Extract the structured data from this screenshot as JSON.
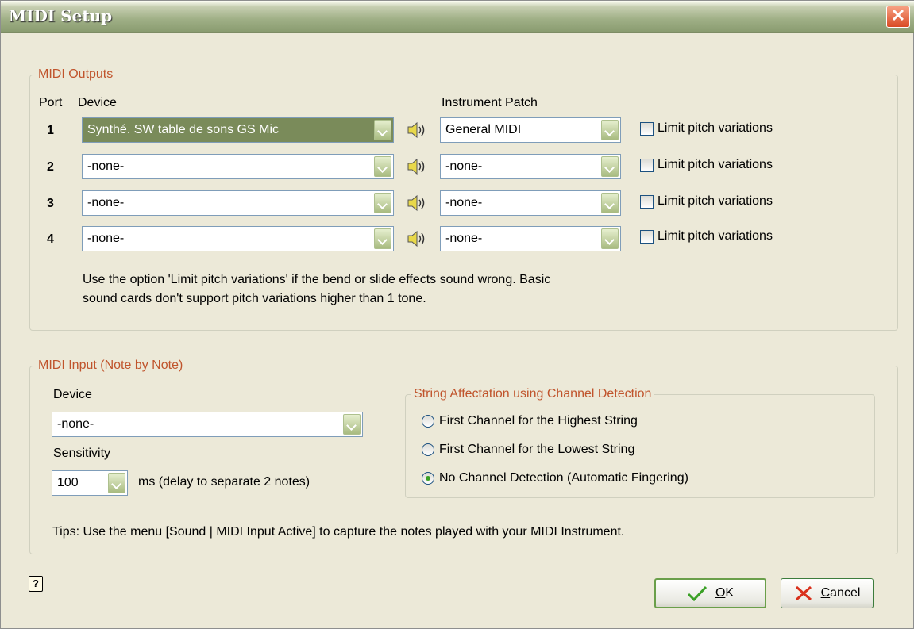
{
  "window": {
    "title": "MIDI Setup",
    "close_glyph": "✕"
  },
  "outputs": {
    "legend": "MIDI Outputs",
    "header_port": "Port",
    "header_device": "Device",
    "header_patch": "Instrument Patch",
    "rows": [
      {
        "port": "1",
        "device": "Synthé. SW table de sons GS Mic",
        "patch": "General MIDI",
        "limit_label": "Limit pitch variations",
        "limit_checked": false
      },
      {
        "port": "2",
        "device": "-none-",
        "patch": "-none-",
        "limit_label": "Limit pitch variations",
        "limit_checked": false
      },
      {
        "port": "3",
        "device": "-none-",
        "patch": "-none-",
        "limit_label": "Limit pitch variations",
        "limit_checked": false
      },
      {
        "port": "4",
        "device": "-none-",
        "patch": "-none-",
        "limit_label": "Limit pitch variations",
        "limit_checked": false
      }
    ],
    "note_line1": "Use the option 'Limit pitch variations' if the bend or slide effects sound wrong. Basic",
    "note_line2": "sound cards don't support pitch variations higher than 1 tone."
  },
  "input": {
    "legend": "MIDI Input (Note by Note)",
    "device_label": "Device",
    "device_value": "-none-",
    "sensitivity_label": "Sensitivity",
    "sensitivity_value": "100",
    "sensitivity_unit": "ms  (delay to separate 2 notes)",
    "string_group": {
      "legend": "String Affectation using Channel Detection",
      "options": [
        {
          "label": "First Channel for the Highest String",
          "selected": false
        },
        {
          "label": "First Channel for the Lowest String",
          "selected": false
        },
        {
          "label": "No Channel Detection (Automatic Fingering)",
          "selected": true
        }
      ]
    },
    "tips": "Tips: Use the menu [Sound | MIDI Input Active] to capture the notes played with your MIDI Instrument."
  },
  "buttons": {
    "help_glyph": "?",
    "ok_mnemonic": "O",
    "ok_rest": "K",
    "cancel_mnemonic": "C",
    "cancel_rest": "ancel"
  },
  "colors": {
    "legend": "#c0542c",
    "titlebar": "#9faf86",
    "ok_check": "#3aa025",
    "cancel_x": "#d9301c"
  }
}
